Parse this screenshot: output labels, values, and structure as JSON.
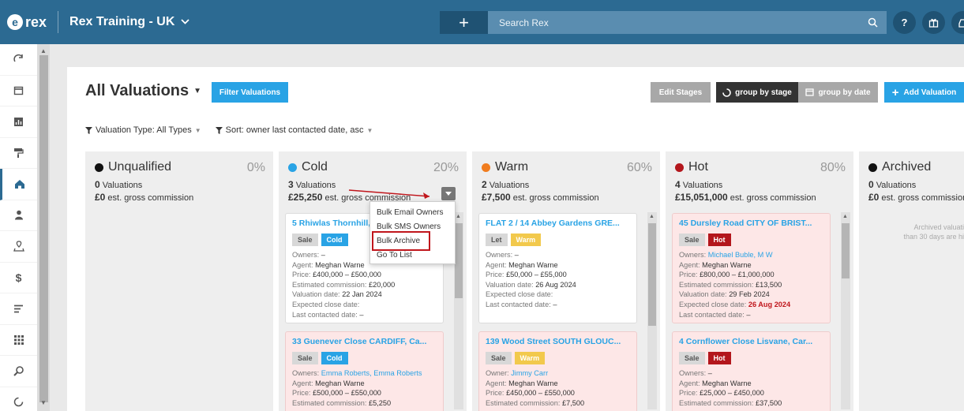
{
  "topbar": {
    "logo_letter": "e",
    "logo_text": "rex",
    "account": "Rex Training - UK",
    "search_placeholder": "Search Rex",
    "help_icon": "?"
  },
  "sidebar": {
    "items": [
      "refresh-icon",
      "calendar-icon",
      "chart-icon",
      "paint-roller-icon",
      "home-icon",
      "person-icon",
      "location-icon",
      "dollar-icon",
      "list-icon",
      "grid-icon",
      "search-doc-icon",
      "loading-icon"
    ]
  },
  "page": {
    "title": "All Valuations",
    "filter_button": "Filter Valuations",
    "edit_stages": "Edit Stages",
    "group_by_stage": "group by stage",
    "group_by_date": "group by date",
    "add_valuation": "Add Valuation",
    "filter_type": "Valuation Type: All Types",
    "sort": "Sort: owner last contacted date, asc"
  },
  "columns": [
    {
      "title": "Unqualified",
      "pct": "0%",
      "count": "0",
      "count_label": "Valuations",
      "comm": "£0",
      "comm_label": "est. gross commission",
      "dot": "#111111"
    },
    {
      "title": "Cold",
      "pct": "20%",
      "count": "3",
      "count_label": "Valuations",
      "comm": "£25,250",
      "comm_label": "est. gross commission",
      "dot": "#29a3e5"
    },
    {
      "title": "Warm",
      "pct": "60%",
      "count": "2",
      "count_label": "Valuations",
      "comm": "£7,500",
      "comm_label": "est. gross commission",
      "dot": "#f07c1e"
    },
    {
      "title": "Hot",
      "pct": "80%",
      "count": "4",
      "count_label": "Valuations",
      "comm": "£15,051,000",
      "comm_label": "est. gross commission",
      "dot": "#b3161c"
    },
    {
      "title": "Archived",
      "pct": "",
      "count": "0",
      "count_label": "Valuations",
      "comm": "£0",
      "comm_label": "est. gross commission",
      "dot": "#111111"
    }
  ],
  "archived_note": [
    "Archived valuati",
    "than 30 days are hi"
  ],
  "cards": {
    "cold1": {
      "title": "5 Rhiwlas Thornhill, ...",
      "tag1": "Sale",
      "tag2": "Cold",
      "owners_l": "Owners:",
      "owners_v": "–",
      "agent_l": "Agent:",
      "agent_v": "Meghan Warne",
      "price_l": "Price:",
      "price_v": "£400,000 – £500,000",
      "comm_l": "Estimated commission:",
      "comm_v": "£20,000",
      "vdate_l": "Valuation date:",
      "vdate_v": "22 Jan 2024",
      "close_l": "Expected close date:",
      "close_v": "",
      "contact_l": "Last contacted date:",
      "contact_v": "–"
    },
    "cold2": {
      "title": "33 Guenever Close CARDIFF, Ca...",
      "tag1": "Sale",
      "tag2": "Cold",
      "owners_l": "Owners:",
      "owner1": "Emma Roberts",
      "owner_sep": ",",
      "owner2": "Emma Roberts",
      "agent_l": "Agent:",
      "agent_v": "Meghan Warne",
      "price_l": "Price:",
      "price_v": "£500,000 – £550,000",
      "comm_l": "Estimated commission:",
      "comm_v": "£5,250"
    },
    "warm1": {
      "title": "FLAT 2 / 14 Abbey Gardens GRE...",
      "tag1": "Let",
      "tag2": "Warm",
      "owners_l": "Owners:",
      "owners_v": "–",
      "agent_l": "Agent:",
      "agent_v": "Meghan Warne",
      "price_l": "Price:",
      "price_v": "£50,000 – £55,000",
      "vdate_l": "Valuation date:",
      "vdate_v": "26 Aug 2024",
      "close_l": "Expected close date:",
      "close_v": "",
      "contact_l": "Last contacted date:",
      "contact_v": "–"
    },
    "warm2": {
      "title": "139 Wood Street SOUTH GLOUC...",
      "tag1": "Sale",
      "tag2": "Warm",
      "owners_l": "Owner:",
      "owner1": "Jimmy Carr",
      "agent_l": "Agent:",
      "agent_v": "Meghan Warne",
      "price_l": "Price:",
      "price_v": "£450,000 – £550,000",
      "comm_l": "Estimated commission:",
      "comm_v": "£7,500"
    },
    "hot1": {
      "title": "45 Dursley Road CITY OF BRIST...",
      "tag1": "Sale",
      "tag2": "Hot",
      "owners_l": "Owners:",
      "owner1": "Michael Buble",
      "owner_sep": ",",
      "owner2": "M W",
      "agent_l": "Agent:",
      "agent_v": "Meghan Warne",
      "price_l": "Price:",
      "price_v": "£800,000 – £1,000,000",
      "comm_l": "Estimated commission:",
      "comm_v": "£13,500",
      "vdate_l": "Valuation date:",
      "vdate_v": "29 Feb 2024",
      "close_l": "Expected close date:",
      "close_v": "26 Aug 2024",
      "contact_l": "Last contacted date:",
      "contact_v": "–"
    },
    "hot2": {
      "title": "4 Cornflower Close Lisvane, Car...",
      "tag1": "Sale",
      "tag2": "Hot",
      "owners_l": "Owners:",
      "owners_v": "–",
      "agent_l": "Agent:",
      "agent_v": "Meghan Warne",
      "price_l": "Price:",
      "price_v": "£25,000 – £450,000",
      "comm_l": "Estimated commission:",
      "comm_v": "£37,500"
    }
  },
  "menu": {
    "items": [
      "Bulk Email Owners",
      "Bulk SMS Owners",
      "Bulk Archive",
      "Go To List"
    ]
  },
  "colors": {
    "brand": "#2c6a92",
    "accent": "#29a3e5",
    "hot": "#b3161c",
    "warm": "#f2c94c",
    "annotation": "#c0161c"
  }
}
